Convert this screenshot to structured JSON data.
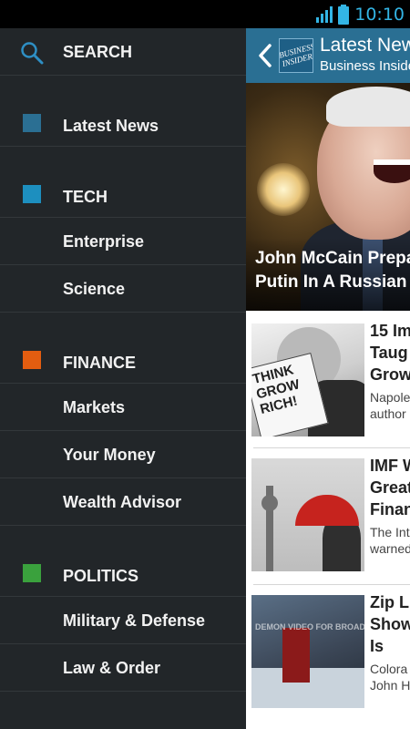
{
  "status_bar": {
    "time": "10:10"
  },
  "drawer": {
    "search_label": "SEARCH",
    "items": [
      {
        "type": "section",
        "label": "Latest News",
        "color": "#2b6f93"
      },
      {
        "type": "section",
        "label": "TECH",
        "color": "#1d8fbf"
      },
      {
        "type": "sub",
        "label": "Enterprise"
      },
      {
        "type": "sub",
        "label": "Science"
      },
      {
        "type": "section",
        "label": "FINANCE",
        "color": "#e35d10"
      },
      {
        "type": "sub",
        "label": "Markets"
      },
      {
        "type": "sub",
        "label": "Your Money"
      },
      {
        "type": "sub",
        "label": "Wealth Advisor"
      },
      {
        "type": "section",
        "label": "POLITICS",
        "color": "#3aa13d"
      },
      {
        "type": "sub",
        "label": "Military & Defense"
      },
      {
        "type": "sub",
        "label": "Law & Order"
      },
      {
        "type": "section",
        "label": "",
        "color": "#c0231e"
      }
    ]
  },
  "action_bar": {
    "title": "Latest News",
    "subtitle": "Business Insider",
    "logo_text": "BUSINESS INSIDER"
  },
  "hero": {
    "title_line1": "John McCain Prepares",
    "title_line2": "Putin In A Russian"
  },
  "articles": [
    {
      "title_lines": [
        "15 Im",
        "Taug",
        "Grow"
      ],
      "snippet_lines": [
        "Napole",
        "author"
      ],
      "thumb_text": "THINK GROW RICH!"
    },
    {
      "title_lines": [
        "IMF W",
        "Great",
        "Finan"
      ],
      "snippet_lines": [
        "The Int",
        "warned"
      ]
    },
    {
      "title_lines": [
        "Zip L",
        "Show",
        "Is"
      ],
      "snippet_lines": [
        "Colora",
        "John H"
      ],
      "thumb_text": "DEMON VIDEO FOR BROADCAST"
    }
  ],
  "colors": {
    "drawer_bg": "#222629",
    "action_bar": "#2a6f93",
    "status_time": "#33b5e5"
  }
}
